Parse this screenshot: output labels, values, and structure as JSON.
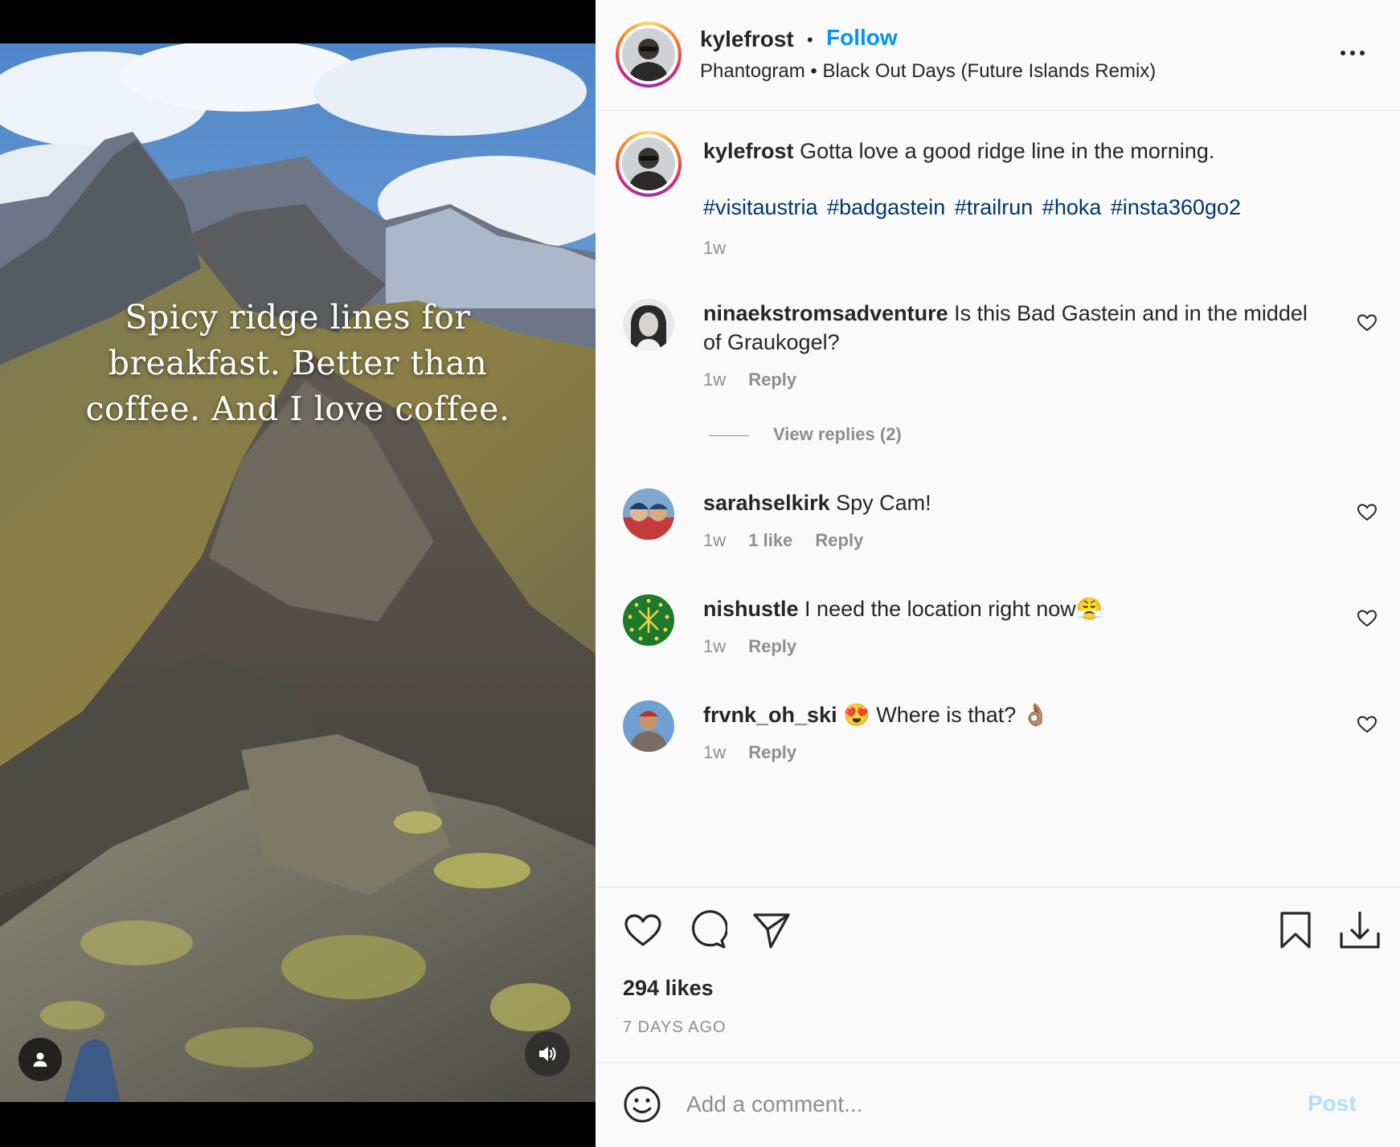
{
  "media": {
    "overlay_lines": [
      "Spicy ridge lines for",
      "breakfast. Better than",
      "coffee. And I love coffee."
    ],
    "tag_icon": "person-icon",
    "sound_icon": "speaker-icon"
  },
  "header": {
    "username": "kylefrost",
    "separator": "•",
    "follow_label": "Follow",
    "song": "Phantogram • Black Out Days (Future Islands Remix)",
    "more_icon": "ellipsis-icon"
  },
  "caption": {
    "username": "kylefrost",
    "text": "Gotta love a good ridge line in the morning.",
    "hashtags": [
      "#visitaustria",
      "#badgastein",
      "#trailrun",
      "#hoka",
      "#insta360go2"
    ],
    "time": "1w"
  },
  "comments": [
    {
      "username": "ninaekstromsadventure",
      "text": "Is this Bad Gastein and in the middel of Graukogel?",
      "time": "1w",
      "likes": "",
      "reply": "Reply"
    },
    {
      "username": "sarahselkirk",
      "text": "Spy Cam!",
      "time": "1w",
      "likes": "1 like",
      "reply": "Reply"
    },
    {
      "username": "nishustle",
      "text": "I need the location right now😤",
      "time": "1w",
      "likes": "",
      "reply": "Reply"
    },
    {
      "username": "frvnk_oh_ski",
      "text": "😍 Where is that? 👌🏽",
      "time": "1w",
      "likes": "",
      "reply": "Reply"
    }
  ],
  "view_replies": "View replies (2)",
  "footer": {
    "likes": "294 likes",
    "ago": "7 DAYS AGO",
    "comment_placeholder": "Add a comment...",
    "post_label": "Post"
  },
  "colors": {
    "link_blue": "#0095f6",
    "hashtag": "#00376b",
    "muted": "#8e8e8e",
    "post_disabled": "#b2dffc"
  }
}
